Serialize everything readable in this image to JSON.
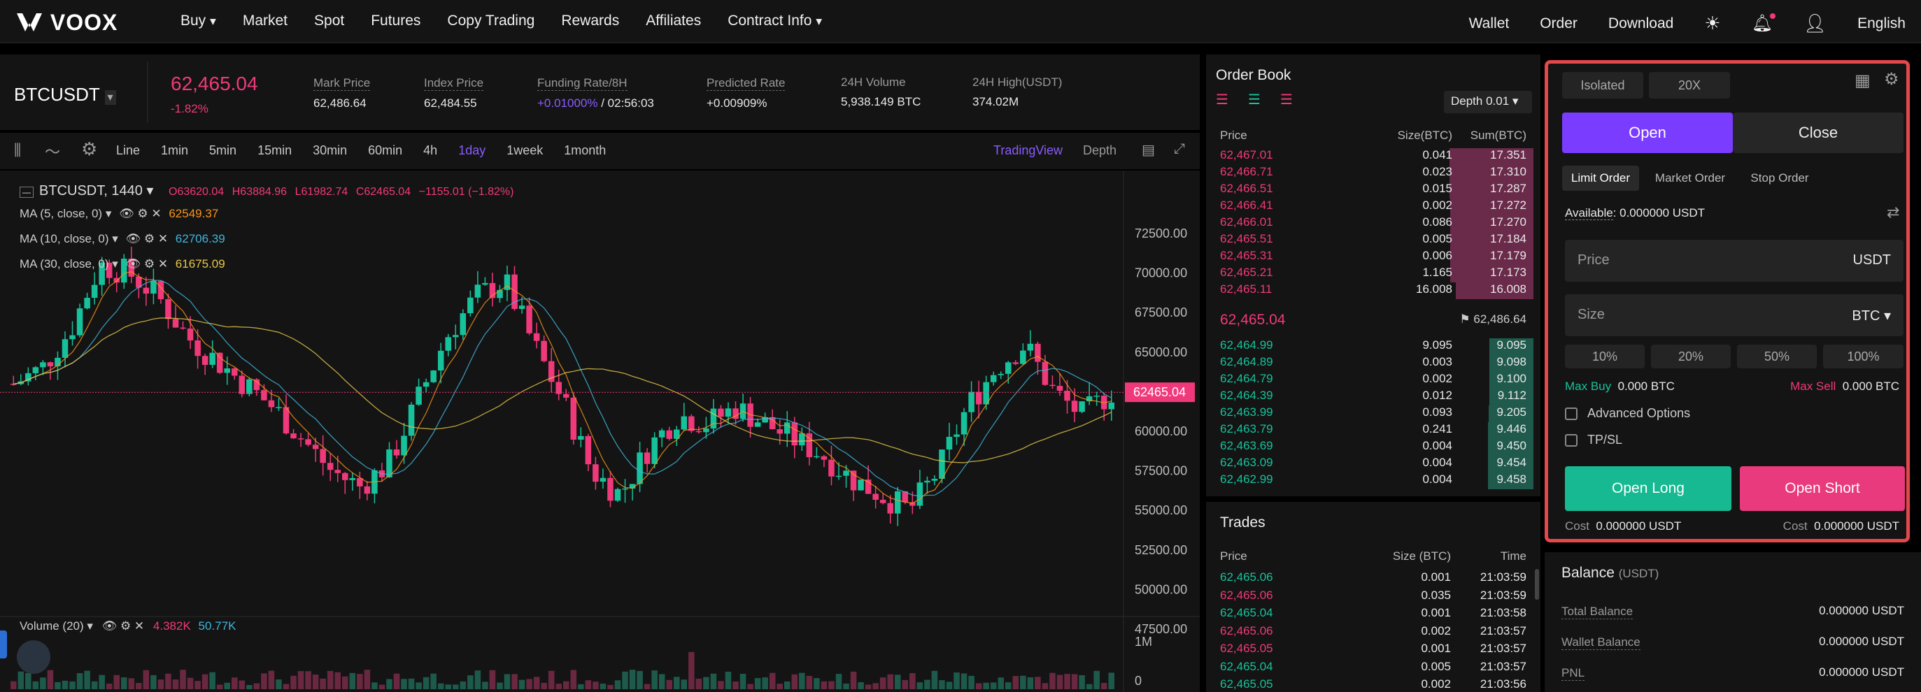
{
  "brand": {
    "logo": "VOOX"
  },
  "nav": {
    "items": [
      "Buy",
      "Market",
      "Spot",
      "Futures",
      "Copy Trading",
      "Rewards",
      "Affiliates",
      "Contract Info"
    ],
    "right": [
      "Wallet",
      "Order",
      "Download",
      "English"
    ]
  },
  "ticker": {
    "symbol": "BTCUSDT",
    "price": "62,465.04",
    "change": "-1.82%",
    "stats": [
      {
        "label": "Mark Price",
        "value": "62,486.64"
      },
      {
        "label": "Index Price",
        "value": "62,484.55"
      },
      {
        "label": "Funding Rate/8H",
        "value": "+0.01000%",
        "value2": "/ 02:56:03"
      },
      {
        "label": "Predicted Rate",
        "value": "+0.00909%"
      },
      {
        "label": "24H Volume",
        "value": "5,938.149 BTC"
      },
      {
        "label": "24H High(USDT)",
        "value": "374.02M"
      }
    ]
  },
  "timeframes": [
    "Line",
    "1min",
    "5min",
    "15min",
    "30min",
    "60min",
    "4h",
    "1day",
    "1week",
    "1month"
  ],
  "views": {
    "tv": "TradingView",
    "depth": "Depth"
  },
  "chart": {
    "title": "BTCUSDT, 1440",
    "o": "O63620.04",
    "h": "H63884.96",
    "l": "L61982.74",
    "c": "C62465.04",
    "chg": "−1155.01 (−1.82%)",
    "ma": [
      {
        "label": "MA (5, close, 0)",
        "value": "62549.37",
        "color": "#f7931a"
      },
      {
        "label": "MA (10, close, 0)",
        "value": "62706.39",
        "color": "#3fb6dd"
      },
      {
        "label": "MA (30, close, 0)",
        "value": "61675.09",
        "color": "#e8c84a"
      }
    ],
    "yticks": [
      "72500.00",
      "70000.00",
      "67500.00",
      "65000.00",
      "62500.00",
      "60000.00",
      "57500.00",
      "55000.00",
      "52500.00",
      "50000.00",
      "47500.00"
    ],
    "current": "62465.04",
    "vol_label": "Volume (20)",
    "vol_a": "4.382K",
    "vol_b": "50.77K",
    "vol_ticks": [
      "1M",
      "0"
    ]
  },
  "chart_data": {
    "type": "candlestick",
    "ylim": [
      47500,
      72500
    ],
    "last": 62465.04
  },
  "orderbook": {
    "title": "Order Book",
    "depth": "Depth 0.01",
    "cols": [
      "Price",
      "Size(BTC)",
      "Sum(BTC)"
    ],
    "asks": [
      [
        "62,467.01",
        "0.041",
        "17.351"
      ],
      [
        "62,466.71",
        "0.023",
        "17.310"
      ],
      [
        "62,466.51",
        "0.015",
        "17.287"
      ],
      [
        "62,466.41",
        "0.002",
        "17.272"
      ],
      [
        "62,466.01",
        "0.086",
        "17.270"
      ],
      [
        "62,465.51",
        "0.005",
        "17.184"
      ],
      [
        "62,465.31",
        "0.006",
        "17.179"
      ],
      [
        "62,465.21",
        "1.165",
        "17.173"
      ],
      [
        "62,465.11",
        "16.008",
        "16.008"
      ]
    ],
    "mid": "62,465.04",
    "mark": "62,486.64",
    "bids": [
      [
        "62,464.99",
        "9.095",
        "9.095"
      ],
      [
        "62,464.89",
        "0.003",
        "9.098"
      ],
      [
        "62,464.79",
        "0.002",
        "9.100"
      ],
      [
        "62,464.39",
        "0.012",
        "9.112"
      ],
      [
        "62,463.99",
        "0.093",
        "9.205"
      ],
      [
        "62,463.79",
        "0.241",
        "9.446"
      ],
      [
        "62,463.69",
        "0.004",
        "9.450"
      ],
      [
        "62,463.09",
        "0.004",
        "9.454"
      ],
      [
        "62,462.99",
        "0.004",
        "9.458"
      ]
    ]
  },
  "trades": {
    "title": "Trades",
    "cols": [
      "Price",
      "Size (BTC)",
      "Time"
    ],
    "rows": [
      [
        "62,465.06",
        "0.001",
        "21:03:59",
        "g"
      ],
      [
        "62,465.06",
        "0.035",
        "21:03:59",
        "r"
      ],
      [
        "62,465.04",
        "0.001",
        "21:03:58",
        "g"
      ],
      [
        "62,465.06",
        "0.002",
        "21:03:57",
        "r"
      ],
      [
        "62,465.05",
        "0.001",
        "21:03:57",
        "r"
      ],
      [
        "62,465.04",
        "0.005",
        "21:03:57",
        "g"
      ],
      [
        "62,465.05",
        "0.002",
        "21:03:56",
        "g"
      ]
    ]
  },
  "trade": {
    "margin": "Isolated",
    "leverage": "20X",
    "open": "Open",
    "close": "Close",
    "types": [
      "Limit Order",
      "Market Order",
      "Stop Order"
    ],
    "avail_label": "Available",
    "avail": ": 0.000000 USDT",
    "price_ph": "Price",
    "price_unit": "USDT",
    "size_ph": "Size",
    "size_unit": "BTC",
    "pcts": [
      "10%",
      "20%",
      "50%",
      "100%"
    ],
    "max_buy_l": "Max Buy",
    "max_buy": "0.000 BTC",
    "max_sell_l": "Max Sell",
    "max_sell": "0.000 BTC",
    "adv": "Advanced Options",
    "tpsl": "TP/SL",
    "long": "Open Long",
    "short": "Open Short",
    "cost_l": "Cost",
    "cost_long": "0.000000 USDT",
    "cost_short": "0.000000 USDT"
  },
  "balance": {
    "title": "Balance",
    "unit": "(USDT)",
    "rows": [
      {
        "label": "Total Balance",
        "value": "0.000000 USDT"
      },
      {
        "label": "Wallet Balance",
        "value": "0.000000 USDT"
      },
      {
        "label": "PNL",
        "value": "0.000000 USDT"
      }
    ]
  }
}
